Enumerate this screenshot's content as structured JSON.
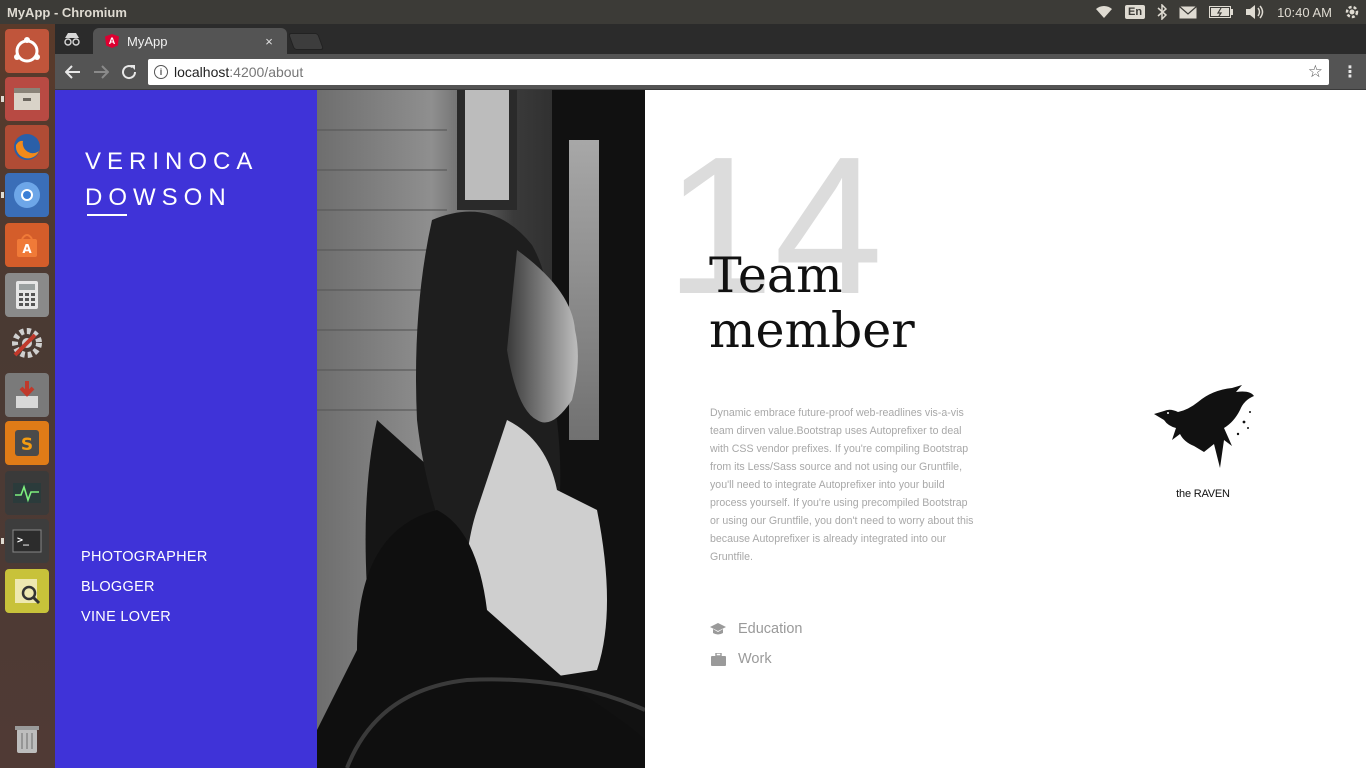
{
  "system": {
    "window_title": "MyApp - Chromium",
    "language": "En",
    "clock": "10:40 AM"
  },
  "browser": {
    "tab_title": "MyApp",
    "tab_close": "×",
    "url_host": "localhost",
    "url_path": ":4200/about"
  },
  "sidebar": {
    "name_line1": "VERINOCA",
    "name_line2": "DOWSON",
    "roles": [
      "PHOTOGRAPHER",
      "BLOGGER",
      "VINE LOVER"
    ]
  },
  "content": {
    "big_number": "14",
    "heading_line1": "Team",
    "heading_line2": "member",
    "bio": "Dynamic embrace future-proof web-readlines vis-a-vis team dirven value.Bootstrap uses Autoprefixer to deal with CSS vendor prefixes. If you're compiling Bootstrap from its Less/Sass source and not using our Gruntfile, you'll need to integrate Autoprefixer into your build process yourself. If you're using precompiled Bootstrap or using our Gruntfile, you don't need to worry about this because Autoprefixer is already integrated into our Gruntfile.",
    "links": [
      {
        "icon": "graduation-cap-icon",
        "label": "Education"
      },
      {
        "icon": "briefcase-icon",
        "label": "Work"
      }
    ],
    "logo_caption": "the RAVEN"
  },
  "colors": {
    "sidebar_bg": "#3f33d8",
    "ubuntu_panel": "#3c3b37",
    "chromium_toolbar": "#545454"
  }
}
